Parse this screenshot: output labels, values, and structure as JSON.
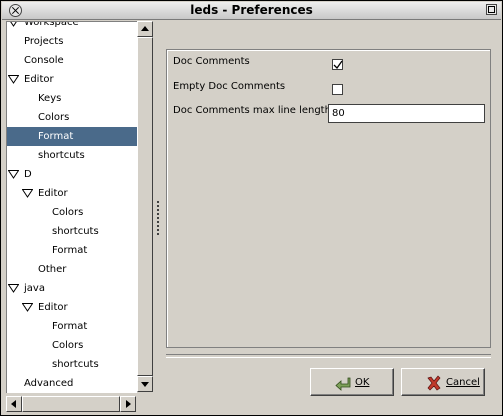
{
  "window": {
    "title": "leds - Preferences"
  },
  "tree": {
    "items": [
      {
        "label": "Workspace",
        "level": 0,
        "expanded": true,
        "selected": false
      },
      {
        "label": "Projects",
        "level": 1,
        "expanded": null,
        "selected": false
      },
      {
        "label": "Console",
        "level": 1,
        "expanded": null,
        "selected": false
      },
      {
        "label": "Editor",
        "level": 0,
        "expanded": true,
        "selected": false
      },
      {
        "label": "Keys",
        "level": 2,
        "expanded": null,
        "selected": false
      },
      {
        "label": "Colors",
        "level": 2,
        "expanded": null,
        "selected": false
      },
      {
        "label": "Format",
        "level": 2,
        "expanded": null,
        "selected": true
      },
      {
        "label": "shortcuts",
        "level": 2,
        "expanded": null,
        "selected": false
      },
      {
        "label": "D",
        "level": 0,
        "expanded": true,
        "selected": false
      },
      {
        "label": "Editor",
        "level": 1,
        "expanded": true,
        "selected": false
      },
      {
        "label": "Colors",
        "level": 3,
        "expanded": null,
        "selected": false
      },
      {
        "label": "shortcuts",
        "level": 3,
        "expanded": null,
        "selected": false
      },
      {
        "label": "Format",
        "level": 3,
        "expanded": null,
        "selected": false
      },
      {
        "label": "Other",
        "level": 2,
        "expanded": null,
        "selected": false
      },
      {
        "label": "java",
        "level": 0,
        "expanded": true,
        "selected": false
      },
      {
        "label": "Editor",
        "level": 1,
        "expanded": true,
        "selected": false
      },
      {
        "label": "Format",
        "level": 3,
        "expanded": null,
        "selected": false
      },
      {
        "label": "Colors",
        "level": 3,
        "expanded": null,
        "selected": false
      },
      {
        "label": "shortcuts",
        "level": 3,
        "expanded": null,
        "selected": false
      },
      {
        "label": "Advanced",
        "level": 1,
        "expanded": null,
        "selected": false
      }
    ]
  },
  "settings": {
    "doc_comments_label": "Doc Comments",
    "doc_comments_checked": true,
    "empty_doc_comments_label": "Empty Doc Comments",
    "empty_doc_comments_checked": false,
    "max_line_length_label": "Doc Comments max line length",
    "max_line_length_value": "80"
  },
  "buttons": {
    "ok_label": "OK",
    "cancel_label": "Cancel"
  },
  "colors": {
    "selection": "#4a6a8a",
    "window_bg": "#d4d0c8"
  }
}
